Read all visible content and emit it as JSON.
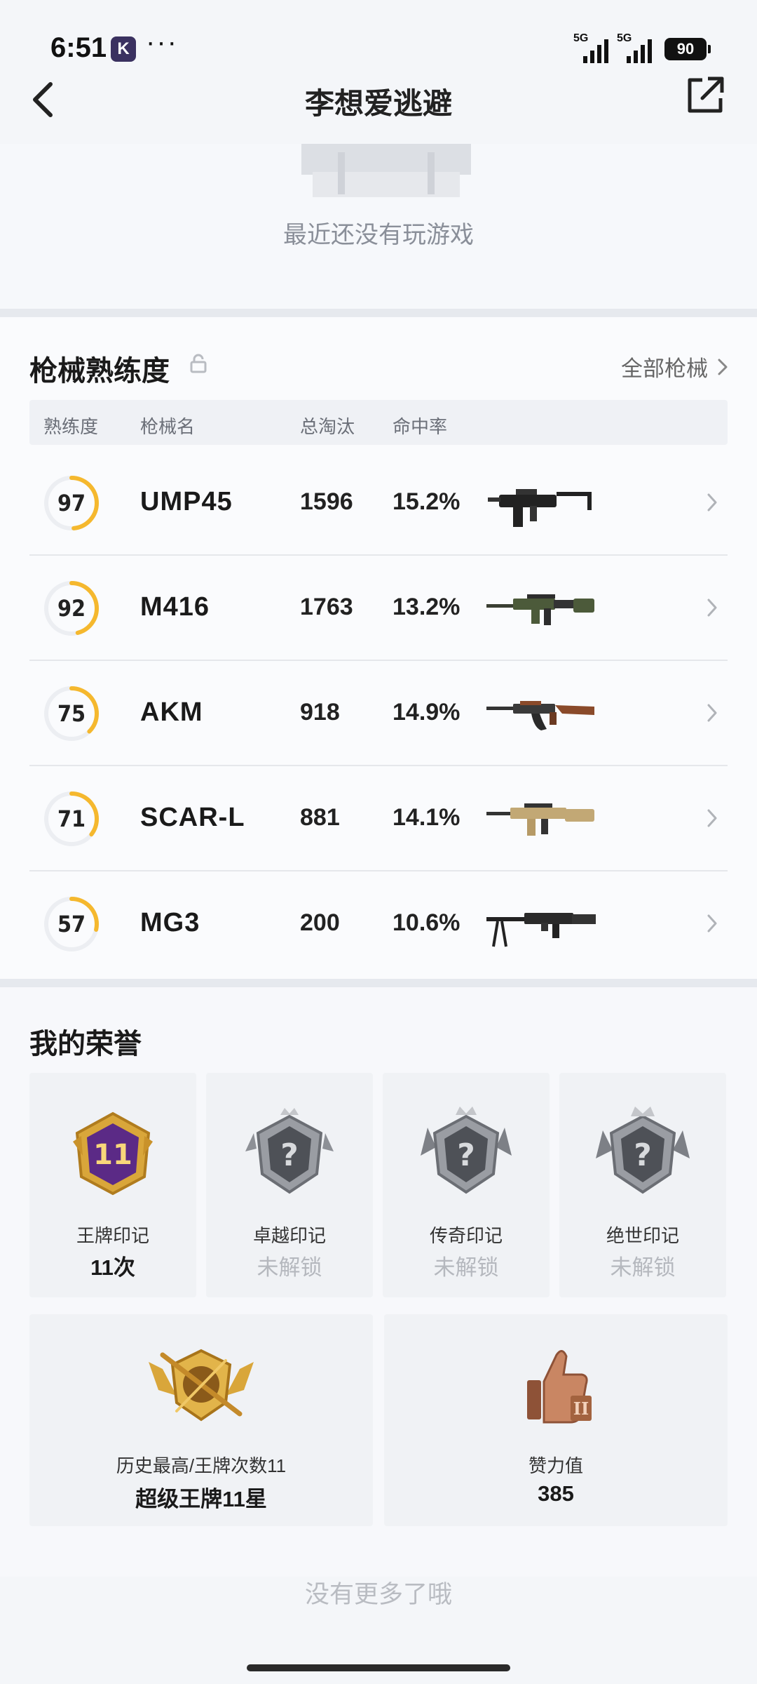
{
  "status_bar": {
    "time": "6:51",
    "app_icon_glyph": "K",
    "more_glyph": "···",
    "signal_1": "5G",
    "signal_2": "5G",
    "battery": "90"
  },
  "header": {
    "title": "李想爱逃避",
    "back_icon": "chevron-left-icon",
    "share_icon": "share-external-icon"
  },
  "recent_games": {
    "empty_text": "最近还没有玩游戏"
  },
  "gun_mastery": {
    "title": "枪械熟练度",
    "all_guns_label": "全部枪械",
    "columns": {
      "mastery": "熟练度",
      "name": "枪械名",
      "kills": "总淘汰",
      "accuracy": "命中率"
    },
    "ring_color": "#f5b82e",
    "guns": [
      {
        "mastery": 97,
        "name": "UMP45",
        "kills": "1596",
        "accuracy": "15.2%",
        "icon": "ump45-gun"
      },
      {
        "mastery": 92,
        "name": "M416",
        "kills": "1763",
        "accuracy": "13.2%",
        "icon": "m416-gun"
      },
      {
        "mastery": 75,
        "name": "AKM",
        "kills": "918",
        "accuracy": "14.9%",
        "icon": "akm-gun"
      },
      {
        "mastery": 71,
        "name": "SCAR-L",
        "kills": "881",
        "accuracy": "14.1%",
        "icon": "scar-l-gun"
      },
      {
        "mastery": 57,
        "name": "MG3",
        "kills": "200",
        "accuracy": "10.6%",
        "icon": "mg3-gun"
      }
    ]
  },
  "honors": {
    "title": "我的荣誉",
    "cards": [
      {
        "label": "王牌印记",
        "value": "11次",
        "badge_text": "11",
        "locked": false
      },
      {
        "label": "卓越印记",
        "value": "未解锁",
        "locked": true
      },
      {
        "label": "传奇印记",
        "value": "未解锁",
        "locked": true
      },
      {
        "label": "绝世印记",
        "value": "未解锁",
        "locked": true
      }
    ],
    "wide_cards": [
      {
        "label": "历史最高/王牌次数11",
        "value": "超级王牌11星"
      },
      {
        "label": "赞力值",
        "value": "385"
      }
    ]
  },
  "footer": {
    "no_more_text": "没有更多了哦"
  }
}
